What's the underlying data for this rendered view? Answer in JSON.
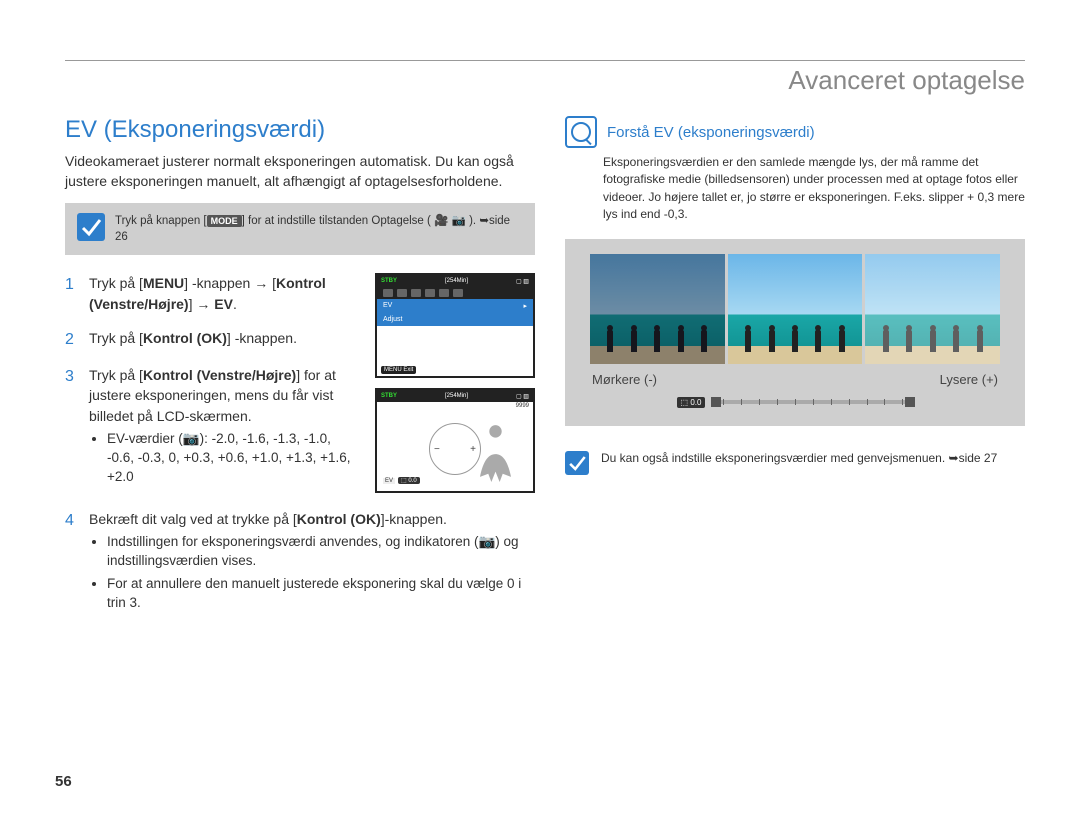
{
  "header": {
    "title": "Avanceret optagelse"
  },
  "section": {
    "title": "EV (Eksponeringsværdi)"
  },
  "intro": "Videokameraet justerer normalt eksponeringen automatisk. Du kan også justere eksponeringen manuelt, alt afhængigt af optagelsesforholdene.",
  "mode_note": {
    "prefix": "Tryk på knappen [",
    "mode": "MODE",
    "suffix": "] for at indstille tilstanden Optagelse (",
    "icons": "🎥 📷",
    "tail": "). ➥side 26"
  },
  "steps": [
    {
      "num": "1",
      "text_parts": [
        "Tryk på [",
        "MENU",
        "] -knappen → [",
        "Kontrol (Venstre/Højre)",
        "] → ",
        "EV",
        "."
      ]
    },
    {
      "num": "2",
      "text_parts": [
        "Tryk på [",
        "Kontrol (OK)",
        "] -knappen."
      ]
    },
    {
      "num": "3",
      "text_parts": [
        "Tryk på [",
        "Kontrol (Venstre/Højre)",
        "] for at justere eksponeringen, mens du får vist billedet på LCD-skærmen."
      ],
      "bullets": [
        "EV-værdier (📷): -2.0, -1.6, -1.3, -1.0, -0.6, -0.3, 0, +0.3, +0.6, +1.0, +1.3, +1.6, +2.0"
      ]
    },
    {
      "num": "4",
      "text_parts": [
        "Bekræft dit valg ved at trykke på [",
        "Kontrol (OK)",
        "]-knappen."
      ],
      "bullets": [
        "Indstillingen for eksponeringsværdi anvendes, og indikatoren (📷) og indstillingsværdien vises.",
        "For at annullere den manuelt justerede eksponering skal du vælge 0 i trin 3."
      ]
    }
  ],
  "lcd1": {
    "stby": "STBY",
    "time": "[254Min]",
    "ev": "EV",
    "adjust": "Adjust",
    "exit": "MENU Exit"
  },
  "lcd2": {
    "stby": "STBY",
    "time": "[254Min]",
    "count": "9999",
    "ev": "EV",
    "val": "0.0"
  },
  "tip": {
    "title": "Forstå EV (eksponeringsværdi)",
    "body": "Eksponeringsværdien er den samlede mængde lys, der må ramme det fotografiske medie (billedsensoren) under processen med at optage fotos eller videoer. Jo højere tallet er, jo større er eksponeringen. F.eks. slipper + 0,3 mere lys ind end -0,3."
  },
  "captions": {
    "left": "Mørkere (-)",
    "right": "Lysere (+)"
  },
  "slider": {
    "badge": "0.0"
  },
  "bottom_note": "Du kan også indstille eksponeringsværdier med genvejsmenuen. ➥side 27",
  "page_number": "56"
}
